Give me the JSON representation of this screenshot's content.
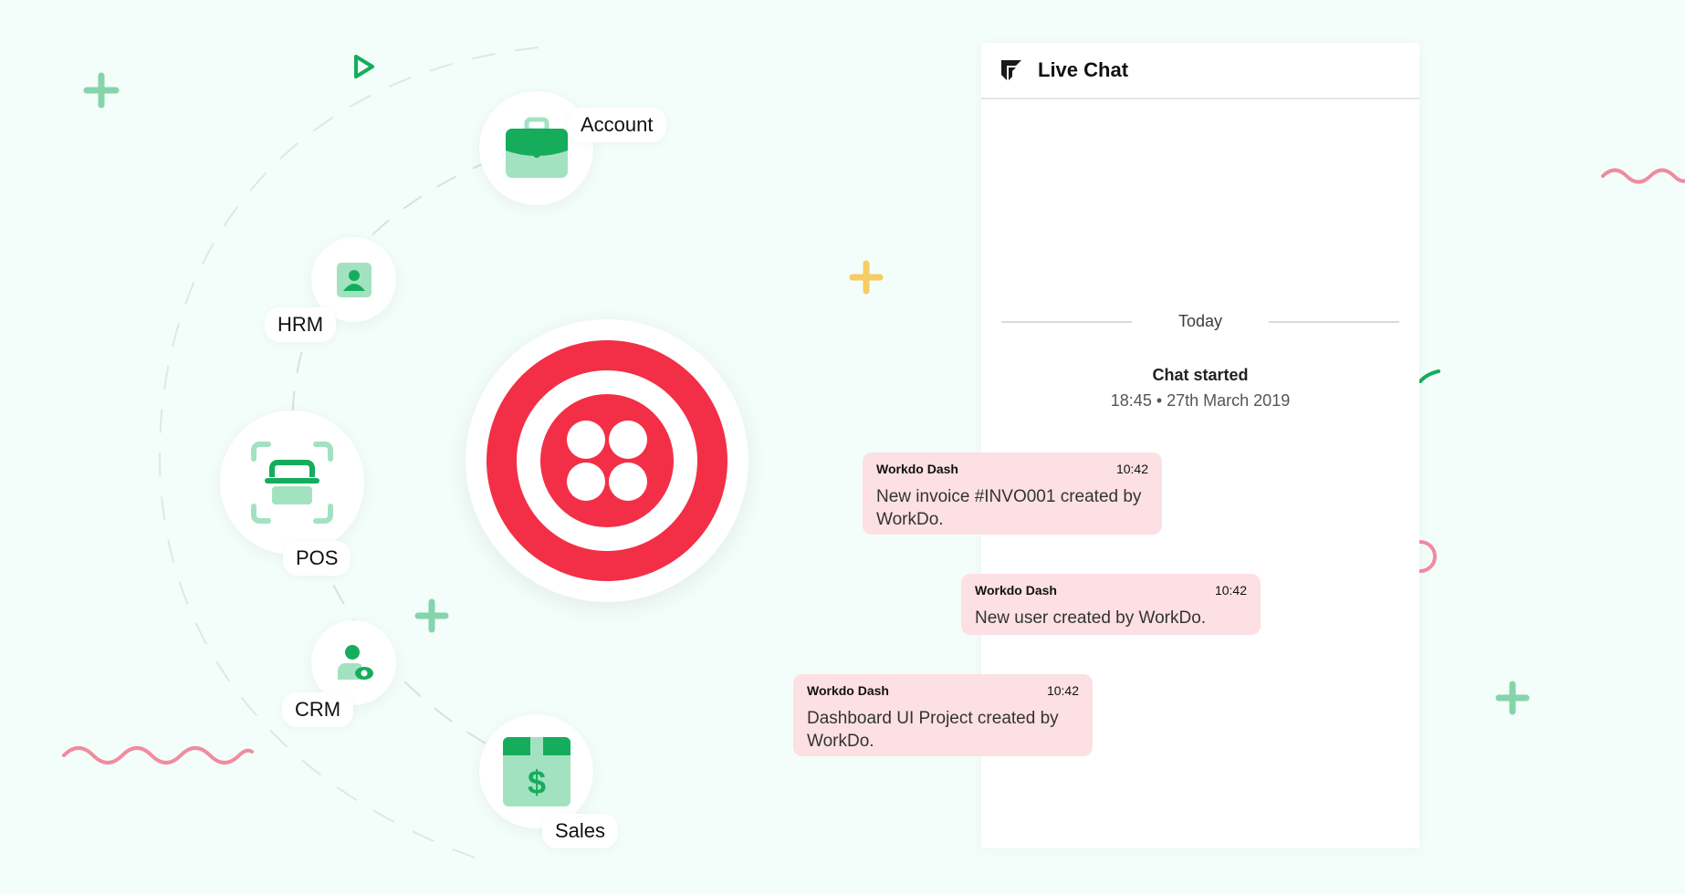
{
  "hub": {
    "nodes": [
      {
        "key": "account",
        "label": "Account",
        "icon": "briefcase-icon"
      },
      {
        "key": "hrm",
        "label": "HRM",
        "icon": "id-card-icon"
      },
      {
        "key": "pos",
        "label": "POS",
        "icon": "scanner-icon"
      },
      {
        "key": "crm",
        "label": "CRM",
        "icon": "user-view-icon"
      },
      {
        "key": "sales",
        "label": "Sales",
        "icon": "money-box-icon"
      }
    ],
    "center_logo": "twilio-logo"
  },
  "chat": {
    "title": "Live Chat",
    "divider_label": "Today",
    "started_label": "Chat started",
    "started_time": "18:45 • 27th March 2019",
    "messages": [
      {
        "sender": "Workdo Dash",
        "time": "10:42",
        "text": "New invoice #INVO001 created by WorkDo."
      },
      {
        "sender": "Workdo Dash",
        "time": "10:42",
        "text": "New user created by WorkDo."
      },
      {
        "sender": "Workdo Dash",
        "time": "10:42",
        "text": "Dashboard UI Project created by WorkDo."
      }
    ]
  },
  "colors": {
    "background": "#f3fdf9",
    "brand_green": "#15ad5c",
    "light_green": "#a3e2c1",
    "twilio_red": "#f22f46",
    "bubble_pink": "#fde0e3",
    "wave_pink": "#f08ba0",
    "plus_yellow": "#f7cc64"
  }
}
